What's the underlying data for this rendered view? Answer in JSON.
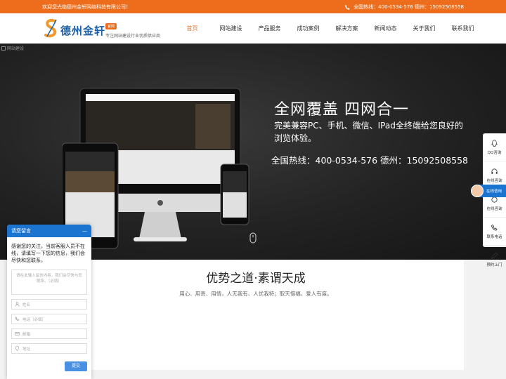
{
  "topbar": {
    "welcome": "欢迎您光临德州金轩网络科技有限公司！",
    "hotline": "全国热线：400-0534-576 德州：15092508558"
  },
  "logo": {
    "name": "德州金轩",
    "badge": "官网",
    "slogan": "专注网站建设行业优质供应商"
  },
  "nav": {
    "items": [
      "首页",
      "网站建设",
      "产品服务",
      "成功案例",
      "解决方案",
      "新闻动态",
      "关于我们",
      "联系我们"
    ],
    "active_index": 0
  },
  "hero": {
    "broken_label": "网站建设",
    "title": "全网覆盖 四网合一",
    "subtitle": "完美兼容PC、手机、微信、IPad全终端给您良好的浏览体验。",
    "hotline": "全国热线：400-0534-576  德州：15092508558"
  },
  "advantage": {
    "title": "优势之道·素谓天成",
    "subtitle": "用心、用贵、用情，人无我有、人优我特；取天惜福，爱人有度。"
  },
  "sidebar": {
    "items": [
      "QQ咨询",
      "在线咨询",
      "在线咨询",
      "联系电话",
      "预约上门"
    ],
    "online_label": "在线咨询"
  },
  "chat": {
    "title": "请您留言",
    "minimize": "—",
    "intro": "感谢您的关注，当前客服人员不在线，请填写一下您的信息，我们会尽快和您联系。",
    "message_placeholder": "请在此输入留言内容，我们会尽快与您联系。（必填）",
    "name_placeholder": "姓名",
    "phone_placeholder": "电话（必填）",
    "email_placeholder": "邮箱",
    "address_placeholder": "地址",
    "submit": "提交"
  },
  "colors": {
    "brand_orange": "#ed6d1c",
    "brand_blue": "#1c74d1"
  }
}
